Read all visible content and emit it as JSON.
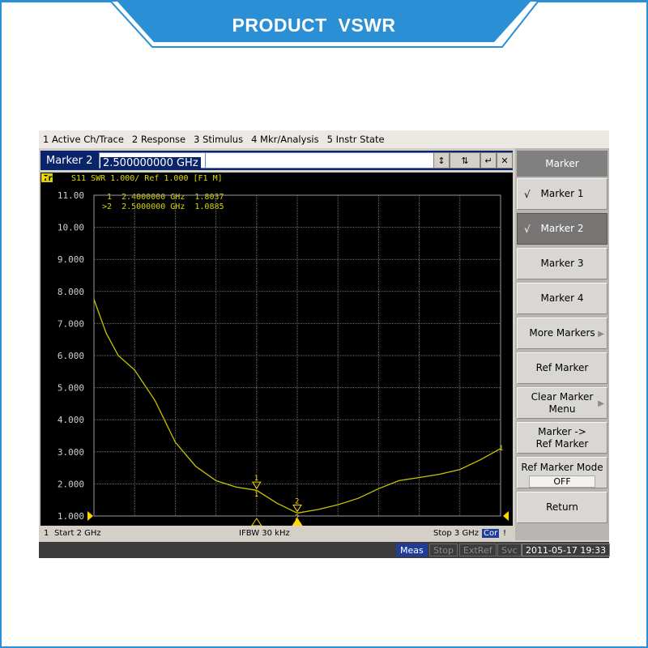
{
  "banner": {
    "title": "PRODUCT  VSWR"
  },
  "menu": [
    "1 Active Ch/Trace",
    "2 Response",
    "3 Stimulus",
    "4 Mkr/Analysis",
    "5 Instr State"
  ],
  "entry": {
    "label": "Marker 2",
    "value": "2.500000000 GHz"
  },
  "trace": {
    "tag": "Tr1",
    "header": "S11  SWR 1.000/ Ref 1.000 [F1 M]",
    "markers": [
      {
        "id": "1",
        "freq": "2.4000000 GHz",
        "value": "1.8037",
        "line": " 1  2.4000000 GHz  1.8037"
      },
      {
        "id": "2",
        "freq": "2.5000000 GHz",
        "value": "1.0885",
        "line": ">2  2.5000000 GHz  1.0885"
      }
    ]
  },
  "chart_data": {
    "type": "line",
    "xlim": [
      2,
      3
    ],
    "ylim": [
      1,
      11
    ],
    "yticks": [
      "11.00",
      "10.00",
      "9.000",
      "8.000",
      "7.000",
      "6.000",
      "5.000",
      "4.000",
      "3.000",
      "2.000",
      "1.000"
    ],
    "x": [
      2.0,
      2.03,
      2.06,
      2.1,
      2.15,
      2.2,
      2.25,
      2.3,
      2.35,
      2.4,
      2.45,
      2.5,
      2.55,
      2.6,
      2.65,
      2.7,
      2.75,
      2.8,
      2.85,
      2.9,
      2.95,
      3.0
    ],
    "y": [
      7.75,
      6.7,
      6.0,
      5.55,
      4.6,
      3.3,
      2.55,
      2.1,
      1.9,
      1.8,
      1.4,
      1.09,
      1.2,
      1.35,
      1.55,
      1.85,
      2.1,
      2.2,
      2.3,
      2.45,
      2.75,
      3.1
    ],
    "trace_color": "#c8c400",
    "grid": true
  },
  "status": {
    "channel": "1",
    "start": "Start 2 GHz",
    "ifbw": "IFBW 30 kHz",
    "stop": "Stop 3 GHz",
    "cor": "Cor",
    "excl": "!"
  },
  "softkeys": {
    "title": "Marker",
    "items": [
      {
        "label": "Marker 1",
        "check": "√"
      },
      {
        "label": "Marker 2",
        "check": "√",
        "selected": true
      },
      {
        "label": "Marker 3"
      },
      {
        "label": "Marker 4"
      },
      {
        "label": "More Markers",
        "arrow": "▶"
      },
      {
        "label": "Ref Marker"
      },
      {
        "label": "Clear Marker\nMenu",
        "arrow": "▶"
      },
      {
        "label": "Marker ->\nRef Marker"
      },
      {
        "label": "Ref Marker Mode",
        "value": "OFF"
      },
      {
        "label": "Return"
      }
    ]
  },
  "bottom": {
    "meas": "Meas",
    "stop": "Stop",
    "extref": "ExtRef",
    "svc": "Svc",
    "datetime": "2011-05-17 19:33"
  },
  "colors": {
    "banner": "#2a8fd4",
    "accent": "#0a246a",
    "marker": "#ffd700"
  }
}
